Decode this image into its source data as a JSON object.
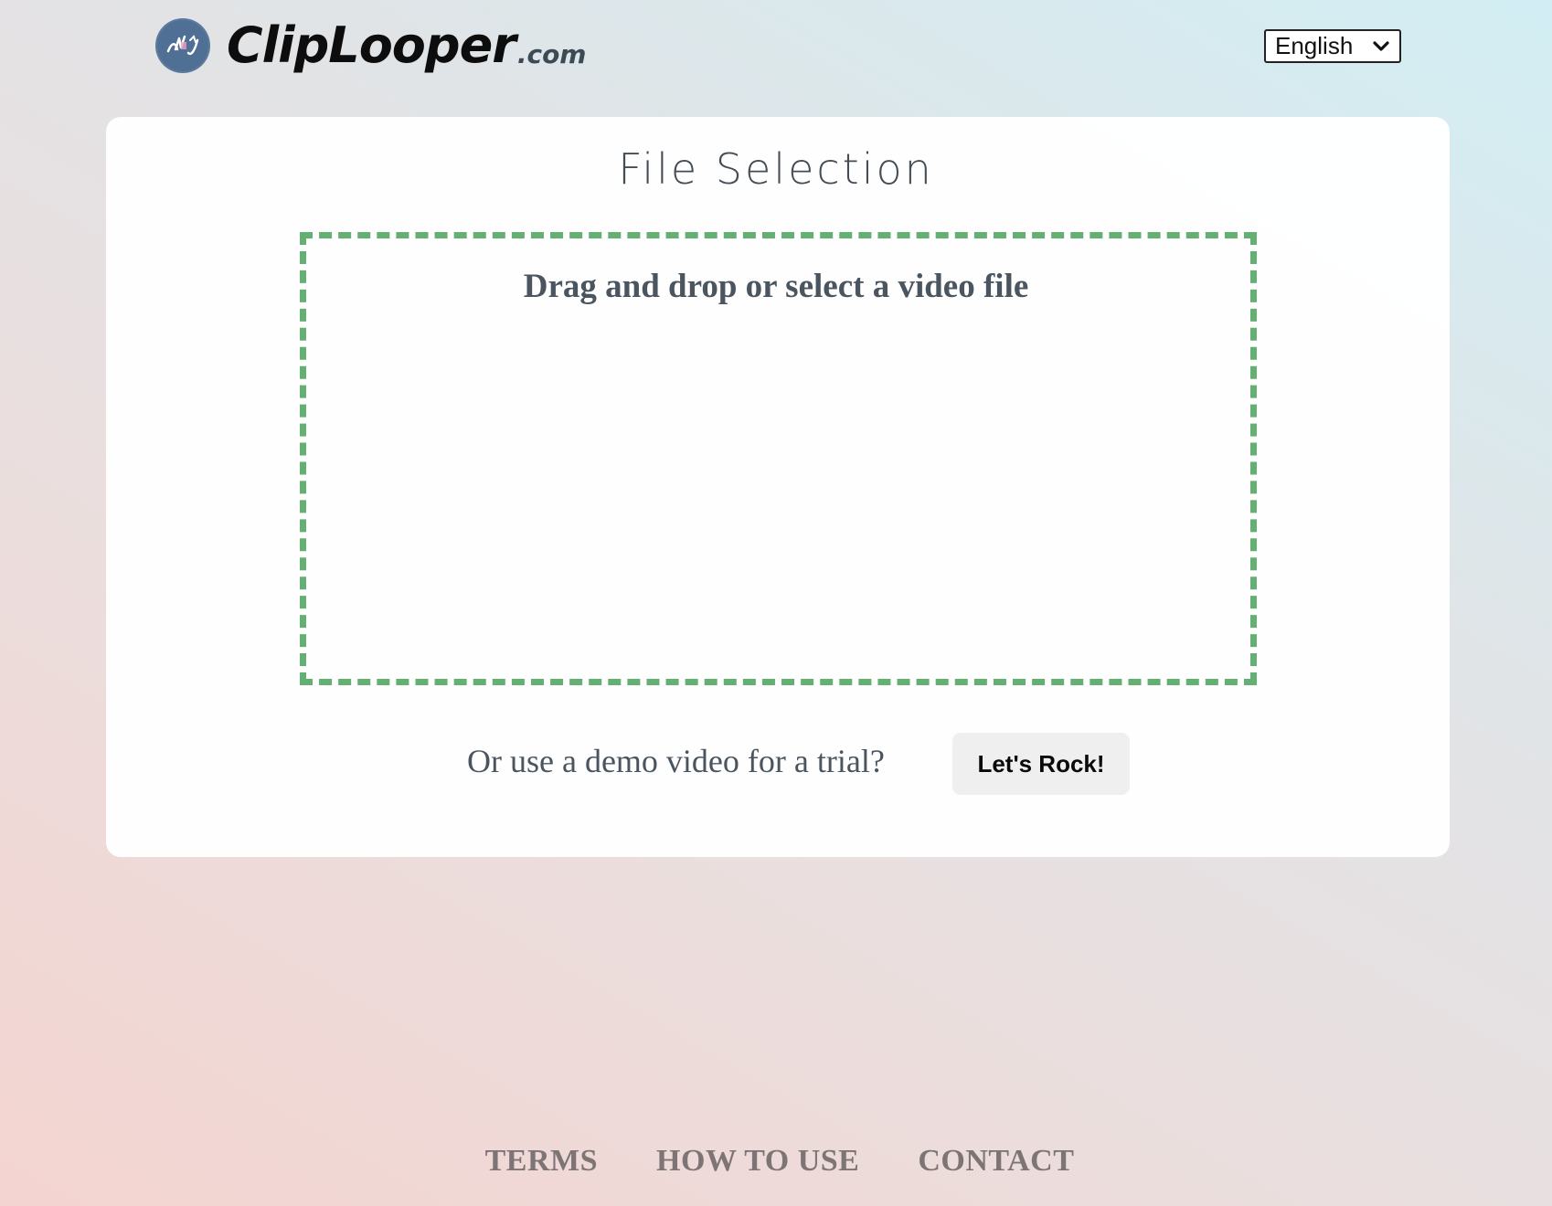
{
  "header": {
    "logo_text": "ClipLooper",
    "logo_suffix": ".com",
    "logo_icon": "cliplooper-logo-icon",
    "language": {
      "selected": "English",
      "icon": "chevron-down-icon"
    }
  },
  "main": {
    "title": "File Selection",
    "dropzone_label": "Drag and drop or select a video file",
    "demo_prompt": "Or use a demo video for a trial?",
    "demo_button_label": "Let's Rock!"
  },
  "footer": {
    "links": [
      {
        "label": "TERMS"
      },
      {
        "label": "HOW TO USE"
      },
      {
        "label": "CONTACT"
      }
    ]
  },
  "colors": {
    "dropzone_border": "#63b072",
    "footer_link": "#7d7575",
    "text": "#4a5560",
    "logo_badge": "#4f6f95"
  }
}
